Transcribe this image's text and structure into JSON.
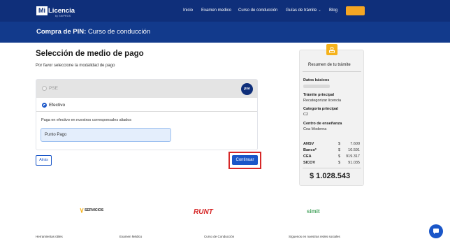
{
  "header": {
    "logo_word1": "Mi",
    "logo_word2": "Licencia",
    "logo_sub": "by SKIPROS",
    "nav": [
      {
        "label": "Inicio"
      },
      {
        "label": "Examen medico"
      },
      {
        "label": "Curso de conducción"
      },
      {
        "label": "Guías de trámite"
      },
      {
        "label": "Blog"
      }
    ],
    "accent": "#f5a623"
  },
  "band": {
    "title_bold": "Compra de PIN:",
    "title_rest": "Curso de conducción"
  },
  "main": {
    "title": "Selección de medio de pago",
    "subtitle": "Por favor seleccione la modalidad de pago",
    "options": {
      "pse_label": "PSE",
      "pse_badge": "pse",
      "efectivo_label": "Efectivo",
      "efectivo_desc": "Paga en efectivo en nuestros corresponsales aliados",
      "agent": "Punto Pago"
    },
    "back_label": "Atrás",
    "continue_label": "Continuar"
  },
  "summary": {
    "title": "Resumen de tu trámite",
    "datos_label": "Datos básicos",
    "tramite_label": "Trámite principal",
    "tramite_value": "Recategorizar licencia",
    "categoria_label": "Categoría principal",
    "categoria_value": "C2",
    "centro_label": "Centro de enseñanza",
    "centro_value": "Cea Moderna",
    "fees": [
      {
        "label": "ANSV",
        "sign": "$",
        "amount": "7.600"
      },
      {
        "label": "Banco*",
        "sign": "$",
        "amount": "10.591"
      },
      {
        "label": "CEA",
        "sign": "$",
        "amount": "919.317"
      },
      {
        "label": "SICOV",
        "sign": "$",
        "amount": "91.035"
      }
    ],
    "total": "$ 1.028.543"
  },
  "partners": {
    "servicios": "SERVICIOS",
    "runt": "RUNT",
    "simit": "simit"
  },
  "footer": {
    "cols": [
      "Herramientas útiles",
      "Examen Médico",
      "Curso de Conducción",
      "Síguenos en nuestras redes sociales"
    ]
  },
  "colors": {
    "primary": "#0f2f7a",
    "band": "#123a8c",
    "button": "#1a56c8",
    "highlight": "#d62828"
  }
}
